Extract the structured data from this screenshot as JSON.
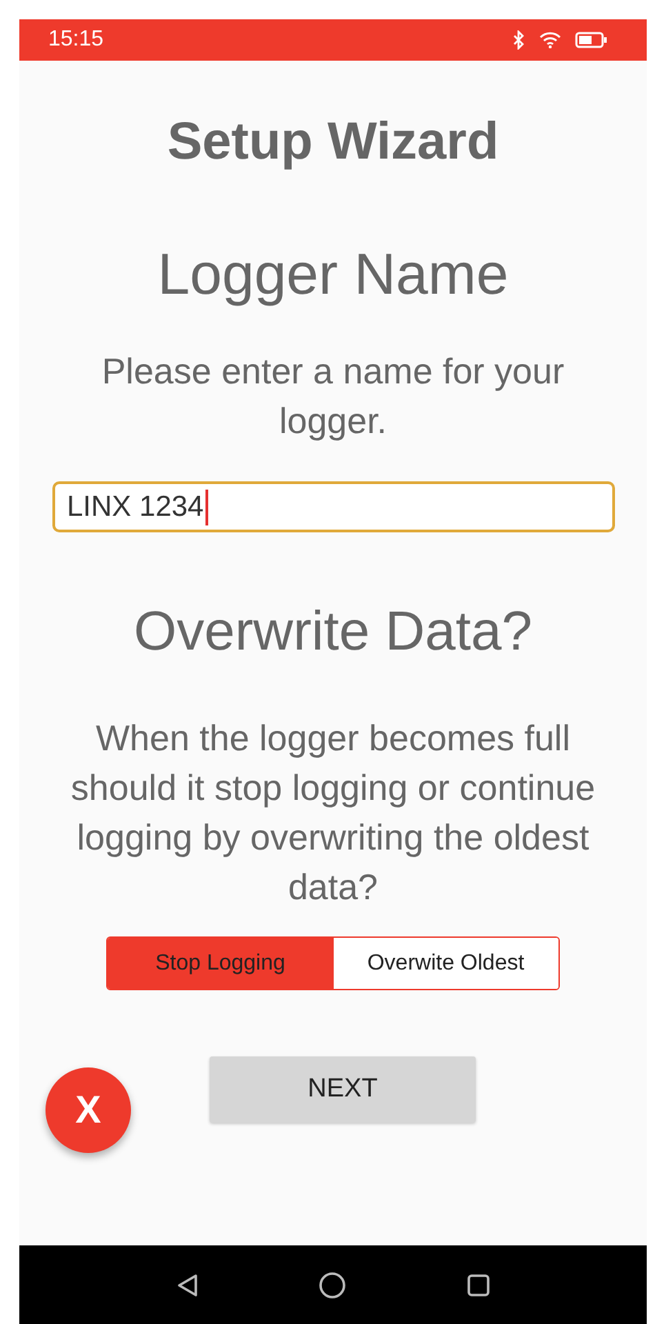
{
  "status_bar": {
    "time": "15:15"
  },
  "title": "Setup Wizard",
  "logger_name": {
    "heading": "Logger Name",
    "prompt": "Please enter a name for your logger.",
    "field": {
      "value": "LINX 1234",
      "focused": true
    }
  },
  "overwrite": {
    "heading": "Overwrite Data?",
    "prompt": "When the logger becomes full should it stop logging or continue logging by overwriting the oldest data?",
    "options": [
      {
        "label": "Stop Logging",
        "selected": true
      },
      {
        "label": "Overwite Oldest",
        "selected": false
      }
    ]
  },
  "next_button": "NEXT",
  "close_fab": "X"
}
